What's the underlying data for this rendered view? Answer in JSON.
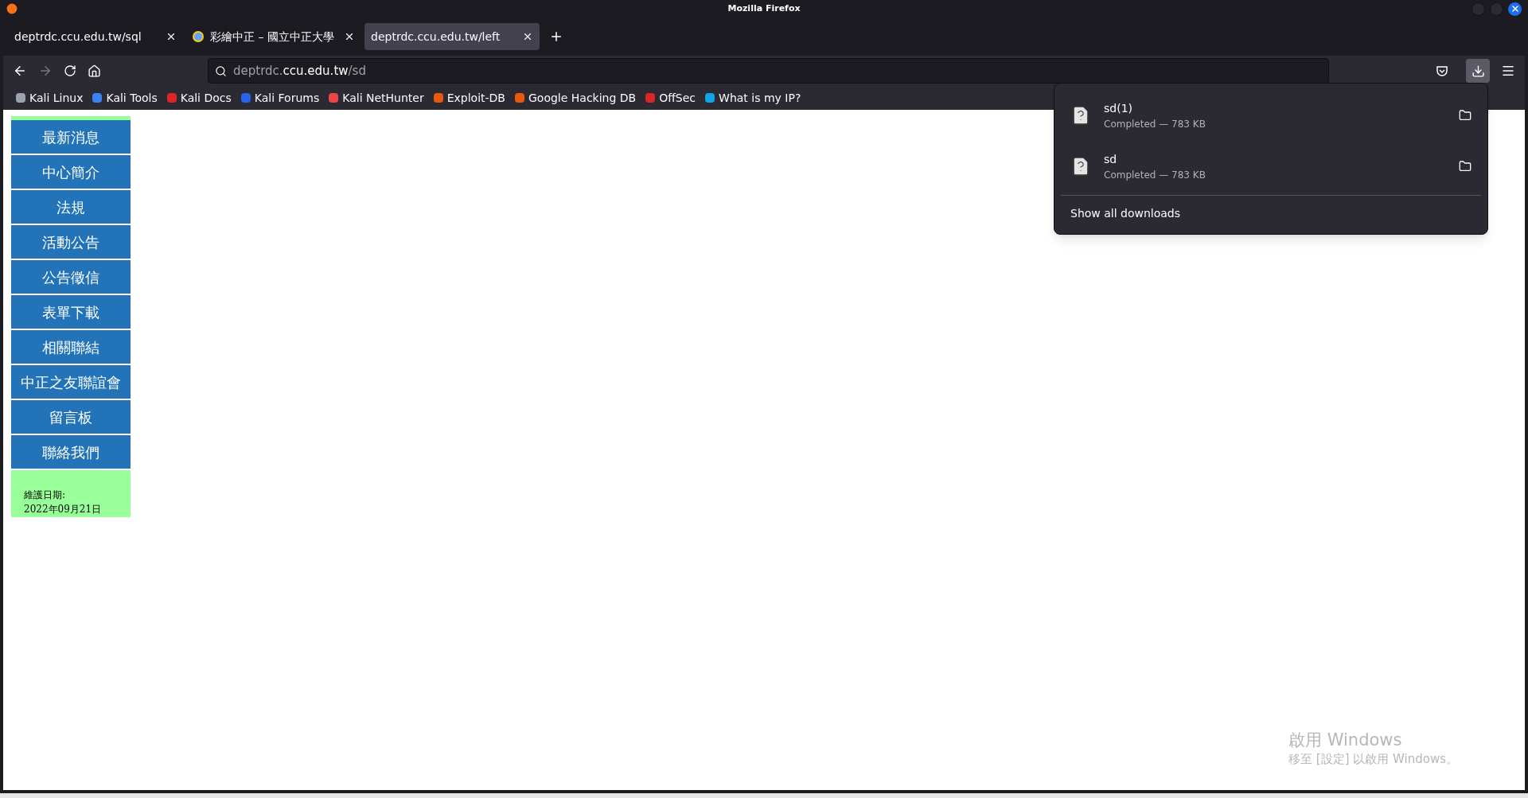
{
  "window": {
    "title": "Mozilla Firefox"
  },
  "tabs": [
    {
      "label": "deptrdc.ccu.edu.tw/sql",
      "selected": false,
      "has_favicon": false
    },
    {
      "label": "彩繪中正 – 國立中正大學",
      "selected": false,
      "has_favicon": true
    },
    {
      "label": "deptrdc.ccu.edu.tw/left",
      "selected": true,
      "has_favicon": false
    }
  ],
  "address_bar": {
    "prefix": "deptrdc.",
    "domain": "ccu.edu.tw",
    "path": "/sd"
  },
  "bookmarks": [
    {
      "label": "Kali Linux",
      "color": "#9ca3af"
    },
    {
      "label": "Kali Tools",
      "color": "#3b82f6"
    },
    {
      "label": "Kali Docs",
      "color": "#dc2626"
    },
    {
      "label": "Kali Forums",
      "color": "#2563eb"
    },
    {
      "label": "Kali NetHunter",
      "color": "#ef4444"
    },
    {
      "label": "Exploit-DB",
      "color": "#ea580c"
    },
    {
      "label": "Google Hacking DB",
      "color": "#ea580c"
    },
    {
      "label": "OffSec",
      "color": "#dc2626"
    },
    {
      "label": "What is my IP?",
      "color": "#0ea5e9"
    }
  ],
  "downloads": {
    "items": [
      {
        "name": "sd(1)",
        "status": "Completed — 783 KB"
      },
      {
        "name": "sd",
        "status": "Completed — 783 KB"
      }
    ],
    "footer": "Show all downloads"
  },
  "sidebar": {
    "items": [
      "最新消息",
      "中心簡介",
      "法規",
      "活動公告",
      "公告徵信",
      "表單下載",
      "相關聯結",
      "中正之友聯誼會",
      "留言板",
      "聯絡我們"
    ],
    "maintenance_label": "維護日期:",
    "maintenance_date": "2022年09月21日"
  },
  "activation_notice": {
    "title": "啟用 Windows",
    "subtitle": "移至 [設定] 以啟用 Windows。"
  }
}
